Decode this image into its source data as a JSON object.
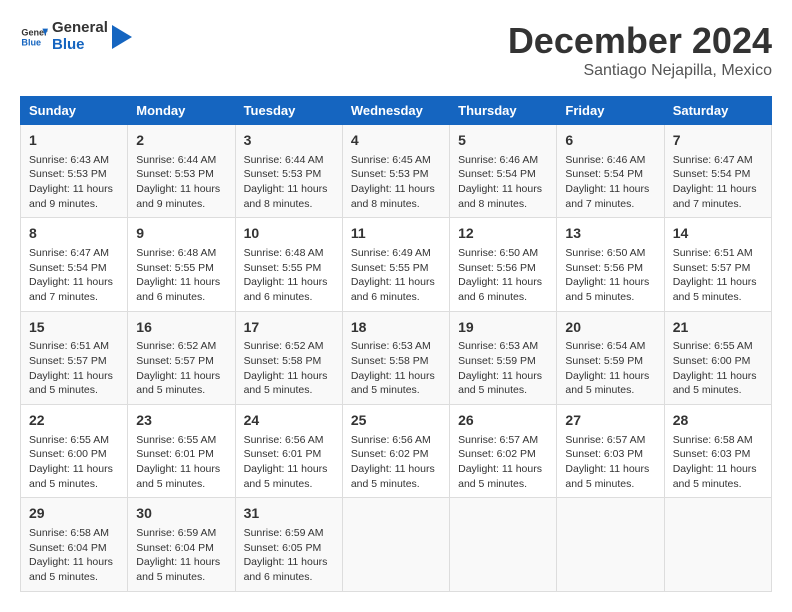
{
  "header": {
    "logo_line1": "General",
    "logo_line2": "Blue",
    "main_title": "December 2024",
    "subtitle": "Santiago Nejapilla, Mexico"
  },
  "days_of_week": [
    "Sunday",
    "Monday",
    "Tuesday",
    "Wednesday",
    "Thursday",
    "Friday",
    "Saturday"
  ],
  "weeks": [
    [
      {
        "day": "1",
        "info": "Sunrise: 6:43 AM\nSunset: 5:53 PM\nDaylight: 11 hours and 9 minutes."
      },
      {
        "day": "2",
        "info": "Sunrise: 6:44 AM\nSunset: 5:53 PM\nDaylight: 11 hours and 9 minutes."
      },
      {
        "day": "3",
        "info": "Sunrise: 6:44 AM\nSunset: 5:53 PM\nDaylight: 11 hours and 8 minutes."
      },
      {
        "day": "4",
        "info": "Sunrise: 6:45 AM\nSunset: 5:53 PM\nDaylight: 11 hours and 8 minutes."
      },
      {
        "day": "5",
        "info": "Sunrise: 6:46 AM\nSunset: 5:54 PM\nDaylight: 11 hours and 8 minutes."
      },
      {
        "day": "6",
        "info": "Sunrise: 6:46 AM\nSunset: 5:54 PM\nDaylight: 11 hours and 7 minutes."
      },
      {
        "day": "7",
        "info": "Sunrise: 6:47 AM\nSunset: 5:54 PM\nDaylight: 11 hours and 7 minutes."
      }
    ],
    [
      {
        "day": "8",
        "info": "Sunrise: 6:47 AM\nSunset: 5:54 PM\nDaylight: 11 hours and 7 minutes."
      },
      {
        "day": "9",
        "info": "Sunrise: 6:48 AM\nSunset: 5:55 PM\nDaylight: 11 hours and 6 minutes."
      },
      {
        "day": "10",
        "info": "Sunrise: 6:48 AM\nSunset: 5:55 PM\nDaylight: 11 hours and 6 minutes."
      },
      {
        "day": "11",
        "info": "Sunrise: 6:49 AM\nSunset: 5:55 PM\nDaylight: 11 hours and 6 minutes."
      },
      {
        "day": "12",
        "info": "Sunrise: 6:50 AM\nSunset: 5:56 PM\nDaylight: 11 hours and 6 minutes."
      },
      {
        "day": "13",
        "info": "Sunrise: 6:50 AM\nSunset: 5:56 PM\nDaylight: 11 hours and 5 minutes."
      },
      {
        "day": "14",
        "info": "Sunrise: 6:51 AM\nSunset: 5:57 PM\nDaylight: 11 hours and 5 minutes."
      }
    ],
    [
      {
        "day": "15",
        "info": "Sunrise: 6:51 AM\nSunset: 5:57 PM\nDaylight: 11 hours and 5 minutes."
      },
      {
        "day": "16",
        "info": "Sunrise: 6:52 AM\nSunset: 5:57 PM\nDaylight: 11 hours and 5 minutes."
      },
      {
        "day": "17",
        "info": "Sunrise: 6:52 AM\nSunset: 5:58 PM\nDaylight: 11 hours and 5 minutes."
      },
      {
        "day": "18",
        "info": "Sunrise: 6:53 AM\nSunset: 5:58 PM\nDaylight: 11 hours and 5 minutes."
      },
      {
        "day": "19",
        "info": "Sunrise: 6:53 AM\nSunset: 5:59 PM\nDaylight: 11 hours and 5 minutes."
      },
      {
        "day": "20",
        "info": "Sunrise: 6:54 AM\nSunset: 5:59 PM\nDaylight: 11 hours and 5 minutes."
      },
      {
        "day": "21",
        "info": "Sunrise: 6:55 AM\nSunset: 6:00 PM\nDaylight: 11 hours and 5 minutes."
      }
    ],
    [
      {
        "day": "22",
        "info": "Sunrise: 6:55 AM\nSunset: 6:00 PM\nDaylight: 11 hours and 5 minutes."
      },
      {
        "day": "23",
        "info": "Sunrise: 6:55 AM\nSunset: 6:01 PM\nDaylight: 11 hours and 5 minutes."
      },
      {
        "day": "24",
        "info": "Sunrise: 6:56 AM\nSunset: 6:01 PM\nDaylight: 11 hours and 5 minutes."
      },
      {
        "day": "25",
        "info": "Sunrise: 6:56 AM\nSunset: 6:02 PM\nDaylight: 11 hours and 5 minutes."
      },
      {
        "day": "26",
        "info": "Sunrise: 6:57 AM\nSunset: 6:02 PM\nDaylight: 11 hours and 5 minutes."
      },
      {
        "day": "27",
        "info": "Sunrise: 6:57 AM\nSunset: 6:03 PM\nDaylight: 11 hours and 5 minutes."
      },
      {
        "day": "28",
        "info": "Sunrise: 6:58 AM\nSunset: 6:03 PM\nDaylight: 11 hours and 5 minutes."
      }
    ],
    [
      {
        "day": "29",
        "info": "Sunrise: 6:58 AM\nSunset: 6:04 PM\nDaylight: 11 hours and 5 minutes."
      },
      {
        "day": "30",
        "info": "Sunrise: 6:59 AM\nSunset: 6:04 PM\nDaylight: 11 hours and 5 minutes."
      },
      {
        "day": "31",
        "info": "Sunrise: 6:59 AM\nSunset: 6:05 PM\nDaylight: 11 hours and 6 minutes."
      },
      {
        "day": "",
        "info": ""
      },
      {
        "day": "",
        "info": ""
      },
      {
        "day": "",
        "info": ""
      },
      {
        "day": "",
        "info": ""
      }
    ]
  ]
}
